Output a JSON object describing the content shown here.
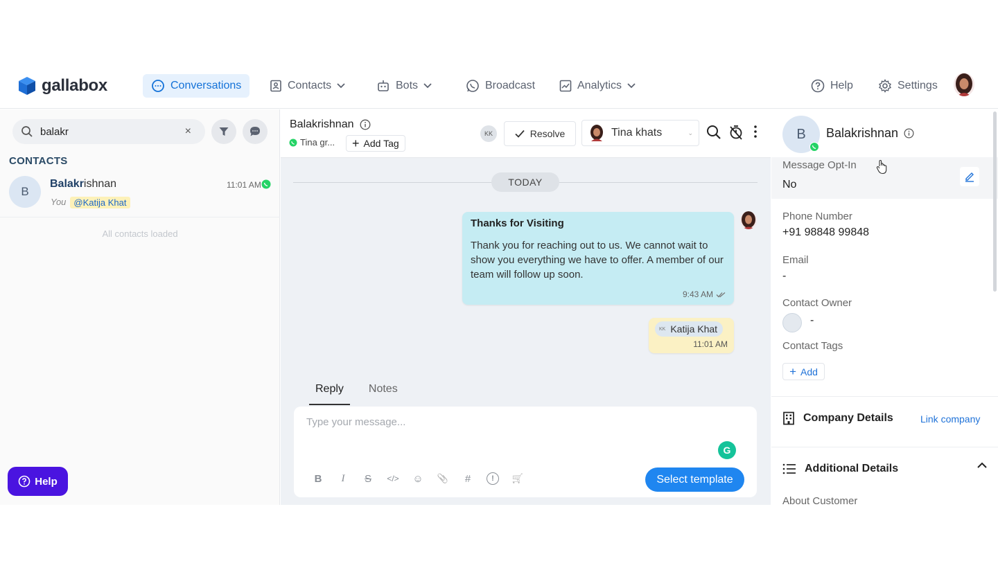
{
  "brand": {
    "name": "gallabox",
    "color": "#1472d8"
  },
  "nav": {
    "items": [
      {
        "label": "Conversations",
        "icon": "chat-bubble-icon",
        "active": true
      },
      {
        "label": "Contacts",
        "icon": "contact-card-icon",
        "dropdown": true
      },
      {
        "label": "Bots",
        "icon": "robot-icon",
        "dropdown": true
      },
      {
        "label": "Broadcast",
        "icon": "whatsapp-icon"
      },
      {
        "label": "Analytics",
        "icon": "chart-icon",
        "dropdown": true
      }
    ],
    "help_label": "Help",
    "settings_label": "Settings"
  },
  "left": {
    "search_value": "balakr",
    "clear_glyph": "×",
    "section_title": "CONTACTS",
    "contact": {
      "initial": "B",
      "name_match": "Balakr",
      "name_rest": "ishnan",
      "time": "11:01 AM",
      "sub_prefix": "You",
      "mention": "@Katija Khat"
    },
    "loaded_text": "All contacts loaded",
    "help_fab": "Help"
  },
  "conversation": {
    "name": "Balakrishnan",
    "channel_text": "Tina gr...",
    "add_tag": "Add Tag",
    "assignee_chip": "KK",
    "resolve_label": "Resolve",
    "assignee_name": "Tina khats",
    "day_label": "TODAY",
    "message1": {
      "title": "Thanks for Visiting",
      "body": "Thank you for reaching out to us. We cannot wait to show you everything we have to offer. A member of our team will follow up soon.",
      "time": "9:43 AM"
    },
    "message2": {
      "chip_initials": "KK",
      "mention": "Katija Khat",
      "time": "11:01 AM"
    },
    "tabs": [
      "Reply",
      "Notes"
    ],
    "composer_placeholder": "Type your message...",
    "grammarly_glyph": "G",
    "toolbar": [
      "B",
      "I",
      "S",
      "</>",
      "☺",
      "📎",
      "#",
      "!",
      "🛒"
    ],
    "send_label": "Select template"
  },
  "details": {
    "initial": "B",
    "name": "Balakrishnan",
    "optin_label": "Message Opt-In",
    "optin_value": "No",
    "phone_label": "Phone Number",
    "phone_value": "+91 98848 99848",
    "email_label": "Email",
    "email_value": "-",
    "owner_label": "Contact Owner",
    "owner_value": "-",
    "tags_label": "Contact Tags",
    "tags_add": "Add",
    "company_label": "Company Details",
    "company_link": "Link company",
    "additional_label": "Additional Details",
    "about_label": "About Customer"
  },
  "colors": {
    "accent": "#1f86f0",
    "whatsapp": "#25d366",
    "help_fab": "#4a14e0",
    "bubble_out": "#c5ecf3",
    "bubble_note": "#fbf1c4"
  }
}
